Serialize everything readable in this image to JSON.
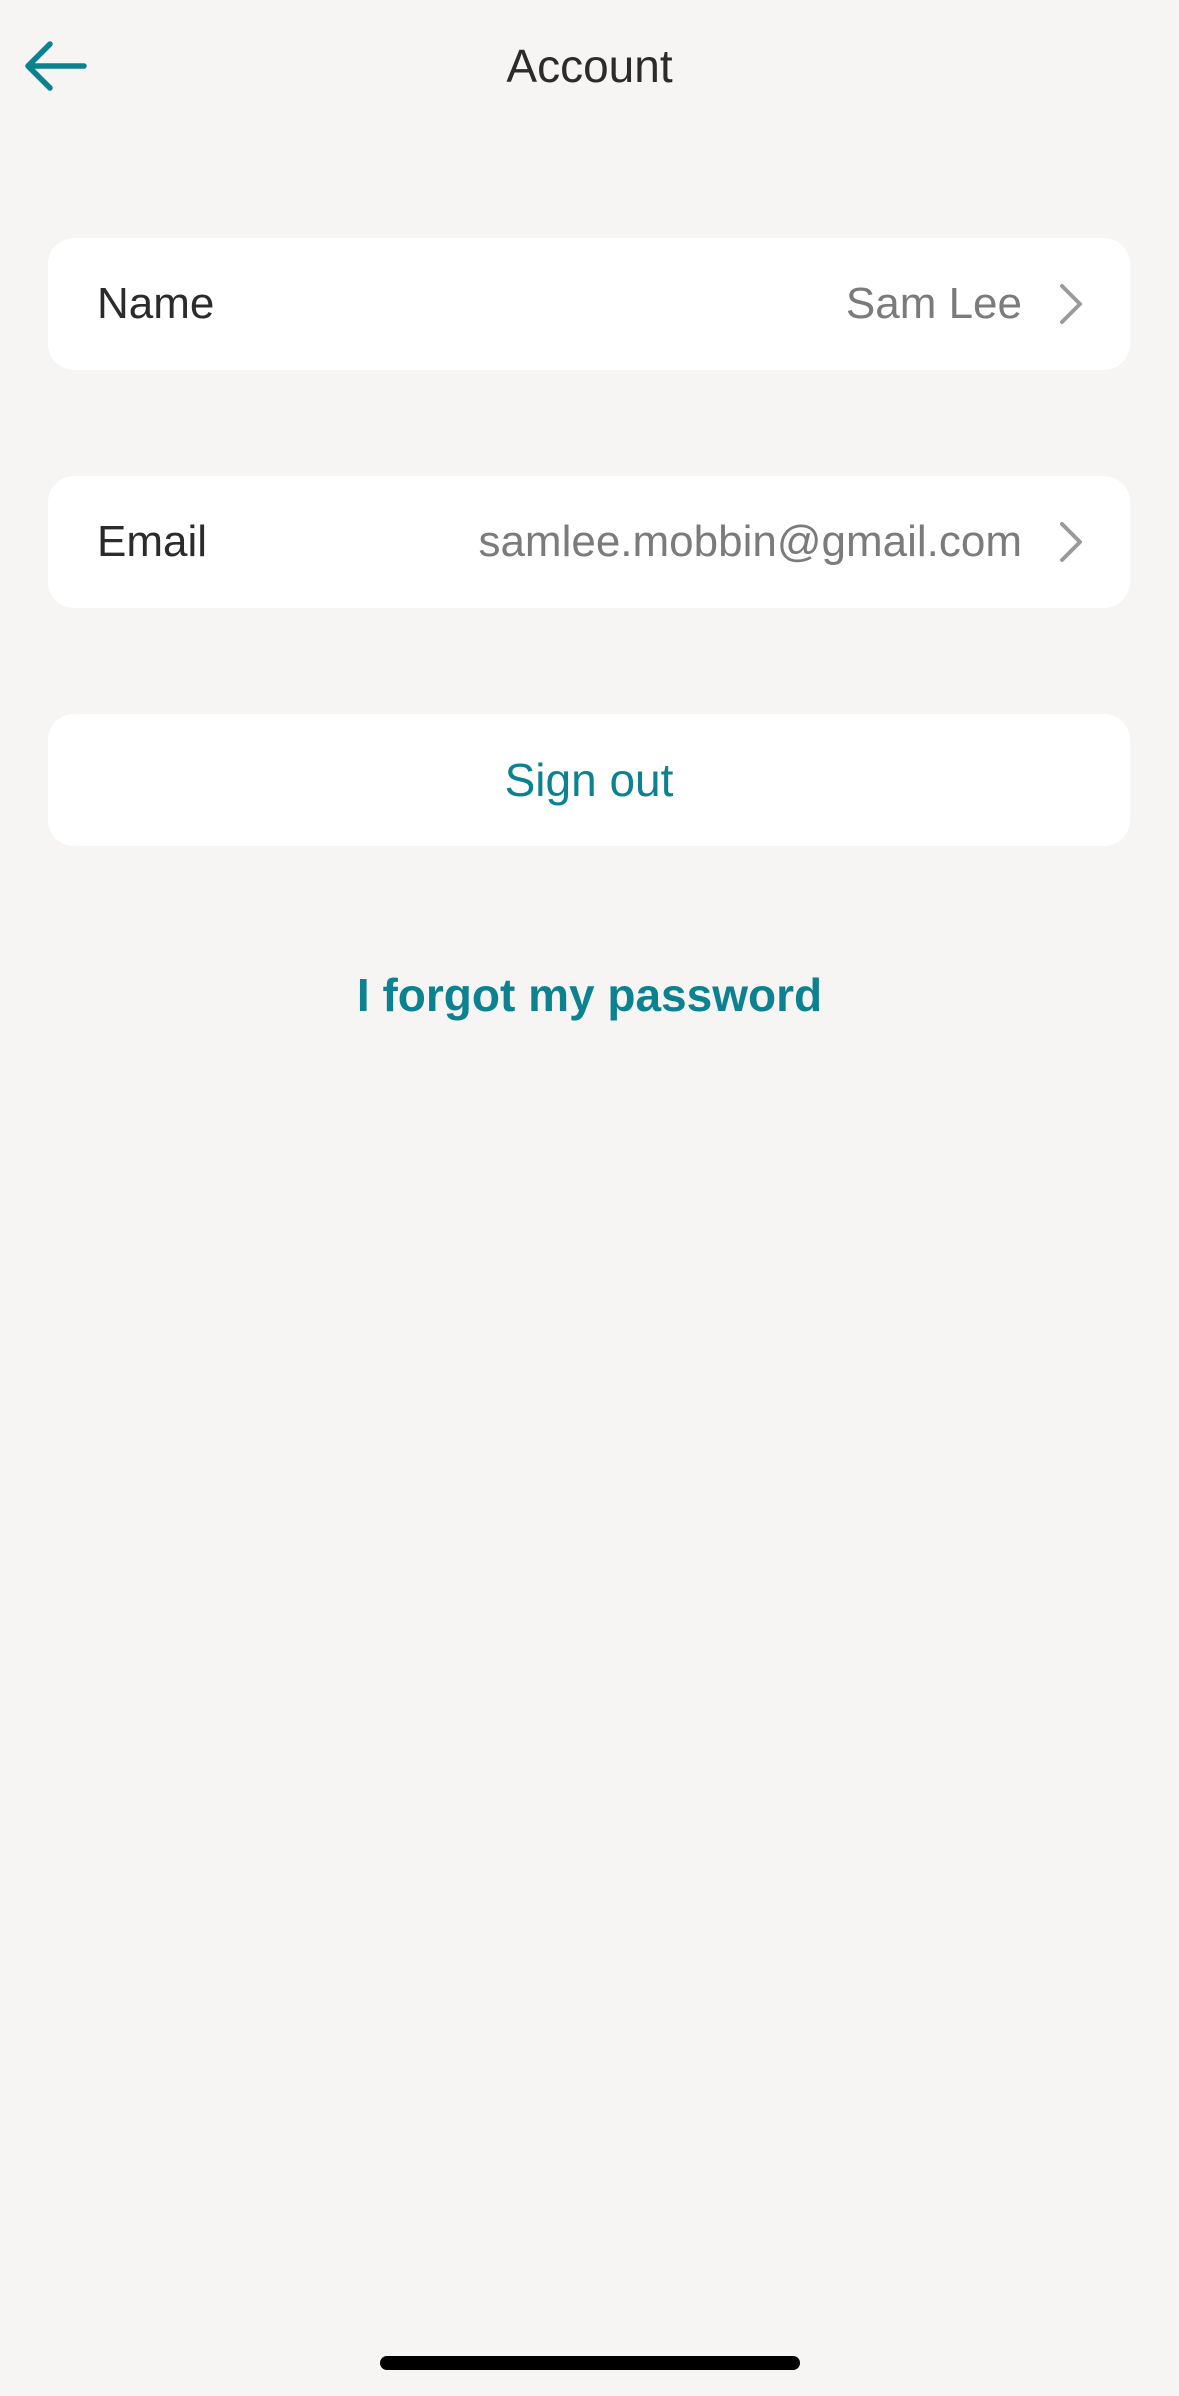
{
  "header": {
    "title": "Account",
    "back_icon": "arrow-left-icon"
  },
  "account_rows": [
    {
      "label": "Name",
      "value": "Sam Lee",
      "icon": "chevron-right-icon"
    },
    {
      "label": "Email",
      "value": "samlee.mobbin@gmail.com",
      "icon": "chevron-right-icon"
    }
  ],
  "sign_out": {
    "label": "Sign out"
  },
  "forgot_password": {
    "label": "I forgot my password"
  },
  "colors": {
    "accent": "#0c8190",
    "background": "#f6f5f4",
    "card": "#ffffff",
    "secondary_text": "#7b7b7b"
  }
}
